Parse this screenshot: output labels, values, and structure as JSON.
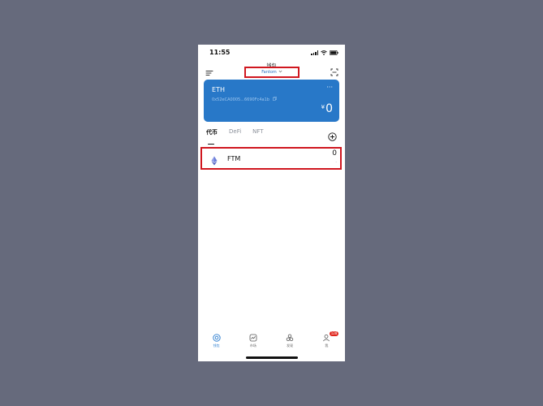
{
  "status_bar": {
    "time": "11:55"
  },
  "header": {
    "title": "钱包",
    "network": "Fantom"
  },
  "wallet_card": {
    "name": "ETH",
    "address": "0x52eCA0005...6690Fc4a1b",
    "currency_symbol": "¥",
    "balance": "0",
    "more": "···"
  },
  "tabs": [
    {
      "label": "代币",
      "active": true
    },
    {
      "label": "DeFi",
      "active": false
    },
    {
      "label": "NFT",
      "active": false
    }
  ],
  "tokens": [
    {
      "name": "FTM",
      "amount": "0",
      "sub": "-"
    }
  ],
  "bottom_nav": [
    {
      "label": "钱包",
      "active": true
    },
    {
      "label": "市场",
      "active": false
    },
    {
      "label": "发现",
      "active": false
    },
    {
      "label": "我",
      "active": false,
      "badge": "128"
    }
  ],
  "colors": {
    "accent": "#2878c8",
    "highlight": "#d0171f",
    "badge": "#e0261d"
  }
}
